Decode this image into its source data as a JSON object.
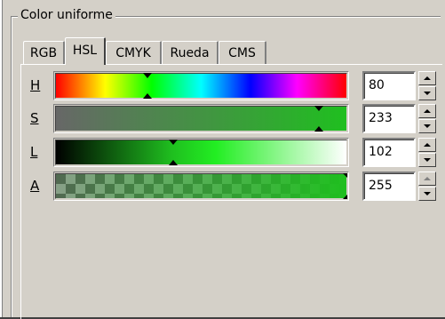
{
  "group": {
    "title": "Color uniforme"
  },
  "tabs": [
    {
      "label": "RGB",
      "active": false
    },
    {
      "label": "HSL",
      "active": true
    },
    {
      "label": "CMYK",
      "active": false
    },
    {
      "label": "Rueda",
      "active": false
    },
    {
      "label": "CMS",
      "active": false
    }
  ],
  "channels": [
    {
      "key": "H",
      "value": "80"
    },
    {
      "key": "S",
      "value": "233"
    },
    {
      "key": "L",
      "value": "102"
    },
    {
      "key": "A",
      "value": "255"
    }
  ],
  "colors": {
    "selected": "#1fbf1f",
    "bright": "#22ee22",
    "background": "#d4d0c8"
  }
}
